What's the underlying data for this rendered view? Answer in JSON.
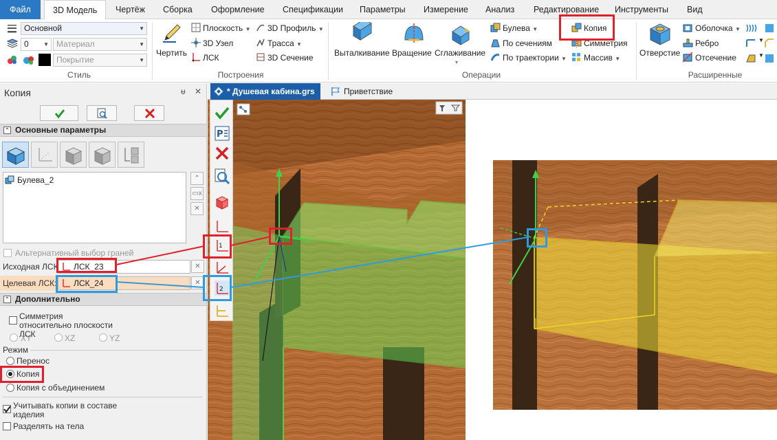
{
  "menu": {
    "file": "Файл",
    "model3d": "3D Модель",
    "drawing": "Чертёж",
    "assembly": "Сборка",
    "design": "Оформление",
    "specs": "Спецификации",
    "params": "Параметры",
    "measure": "Измерение",
    "analysis": "Анализ",
    "edit": "Редактирование",
    "tools": "Инструменты",
    "view": "Вид"
  },
  "ribbon": {
    "style": {
      "label": "Стиль",
      "style_value": "Основной",
      "layer_value": "0",
      "material_placeholder": "Материал",
      "coating_placeholder": "Покрытие"
    },
    "build": {
      "label": "Построения",
      "draw": "Чертить",
      "plane": "Плоскость",
      "node3d": "3D Узел",
      "lcs": "ЛСК",
      "profile3d": "3D Профиль",
      "path": "Трасса",
      "section3d": "3D Сечение"
    },
    "ops": {
      "label": "Операции",
      "extrude": "Выталкивание",
      "rotate": "Вращение",
      "smooth": "Сглаживание",
      "boolean": "Булева",
      "by_sections": "По сечениям",
      "by_path": "По траектории",
      "copy": "Копия",
      "symmetry": "Симметрия",
      "array": "Массив"
    },
    "ext": {
      "label": "Расширенные",
      "hole": "Отверстие",
      "shell": "Оболочка",
      "rib": "Ребро",
      "cut": "Отсечение"
    }
  },
  "panel": {
    "title": "Копия",
    "pin": "ᵾ",
    "close": "✕",
    "main_params": "Основные параметры",
    "list_item": "Булева_2",
    "alt_faces": "Альтернативный выбор граней",
    "source_lcs_label": "Исходная ЛСК:",
    "source_lcs_value": "ЛСК_23",
    "target_lcs_label": "Целевая ЛСК:",
    "target_lcs_value": "ЛСК_24",
    "additional": "Дополнительно",
    "symmetry": "Симметрия относительно плоскости ЛСК",
    "xy": "XY",
    "xz": "XZ",
    "yz": "YZ",
    "mode": "Режим",
    "move": "Перенос",
    "copy": "Копия",
    "copy_union": "Копия с объединением",
    "consider_copies": "Учитывать копии в составе изделия",
    "split_bodies": "Разделять на тела"
  },
  "tabs": {
    "doc": "* Душевая кабина.grs",
    "welcome": "Приветствие"
  },
  "colors": {
    "accent": "#1c5fa8",
    "highlight_red": "#e0202a",
    "highlight_blue": "#2e9be0",
    "selection_green": "#5be04a",
    "preview_yellow": "#f2e23a"
  }
}
